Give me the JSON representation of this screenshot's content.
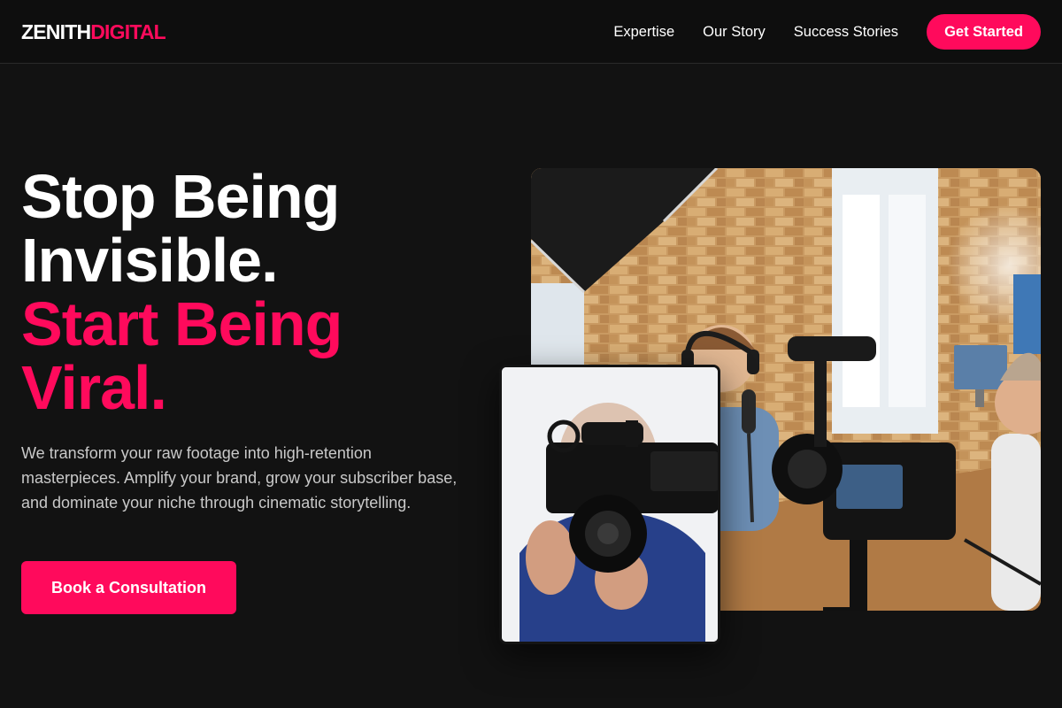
{
  "brand": {
    "part1": "ZENITH",
    "part2": "DIGITAL"
  },
  "nav": {
    "links": [
      "Expertise",
      "Our Story",
      "Success Stories"
    ],
    "cta": "Get Started"
  },
  "hero": {
    "headline_lines": [
      "Stop Being",
      "Invisible."
    ],
    "accent_lines": [
      "Start Being",
      "Viral."
    ],
    "subtext": "We transform your raw footage into high-retention masterpieces. Amplify your brand, grow your subscriber base, and dominate your niche through cinematic storytelling.",
    "cta": "Book a Consultation"
  },
  "theme": {
    "accent": "#ff0a5c",
    "background": "#121212",
    "header_background": "#0e0e0e"
  }
}
